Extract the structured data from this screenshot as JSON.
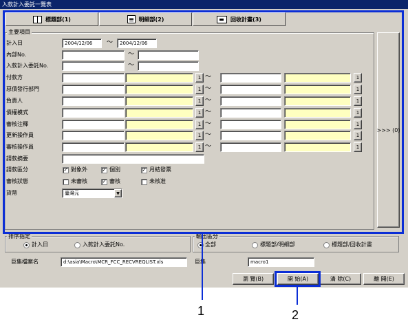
{
  "window": {
    "title": "入款計入委託一覽表"
  },
  "tabs": [
    {
      "label": "標題部(1)"
    },
    {
      "label": "明細部(2)"
    },
    {
      "label": "回收計畫(3)"
    }
  ],
  "main_group": {
    "title": "主要項目"
  },
  "fields": {
    "calc_date": {
      "label": "計入日",
      "from": "2004/12/06",
      "to": "2004/12/06"
    },
    "internal_no": {
      "label": "內部No."
    },
    "entrust_no": {
      "label": "入款計入委託No."
    },
    "payer": {
      "label": "付款方"
    },
    "debt_dept": {
      "label": "惡債發行部門"
    },
    "debtor": {
      "label": "負責人"
    },
    "debt_mode": {
      "label": "債權模式"
    },
    "review_note": {
      "label": "審核注釋"
    },
    "update_operator": {
      "label": "更新操作員"
    },
    "review_operator": {
      "label": "審核操作員"
    },
    "request_summary": {
      "label": "請款摘要"
    },
    "request_type": {
      "label": "請款區分"
    },
    "review_status": {
      "label": "審核狀態"
    },
    "currency": {
      "label": "貨幣",
      "value": "臺灣元"
    }
  },
  "request_type_options": [
    {
      "label": "對象外",
      "checked": true
    },
    {
      "label": "個別",
      "checked": true
    },
    {
      "label": "月結發票",
      "checked": true
    }
  ],
  "review_status_options": [
    {
      "label": "未審核",
      "checked": false
    },
    {
      "label": "審核",
      "checked": true
    },
    {
      "label": "未核准",
      "checked": false
    }
  ],
  "lookup_button_label": "1",
  "tilde": "〜",
  "more_button_label": ">>> (0)",
  "sort_group": {
    "title": "排序指定",
    "options": [
      {
        "label": "計入日",
        "selected": true
      },
      {
        "label": "入款計入委託No.",
        "selected": false
      }
    ]
  },
  "output_group": {
    "title": "輸出區分",
    "options": [
      {
        "label": "全部",
        "selected": true
      },
      {
        "label": "標題部/明細部",
        "selected": false
      },
      {
        "label": "標題部/回收計畫",
        "selected": false
      }
    ]
  },
  "macro_file": {
    "label": "巨集檔案名",
    "value": "d:\\asia\\Macro\\MCR_FCC_RECVREQLIST.xls"
  },
  "macro": {
    "label": "巨集",
    "value": "macro1"
  },
  "buttons": {
    "browse": "瀏 覽(B)",
    "start": "開 始(A)",
    "clear": "清 除(C)",
    "close": "離 開(E)"
  },
  "annotations": {
    "callout1": "1",
    "callout2": "2"
  },
  "colors": {
    "highlight": "#0b2ed6",
    "required_field": "#ffffc0",
    "title_bar": "#0a246a",
    "window_bg": "#d4d0c8"
  }
}
